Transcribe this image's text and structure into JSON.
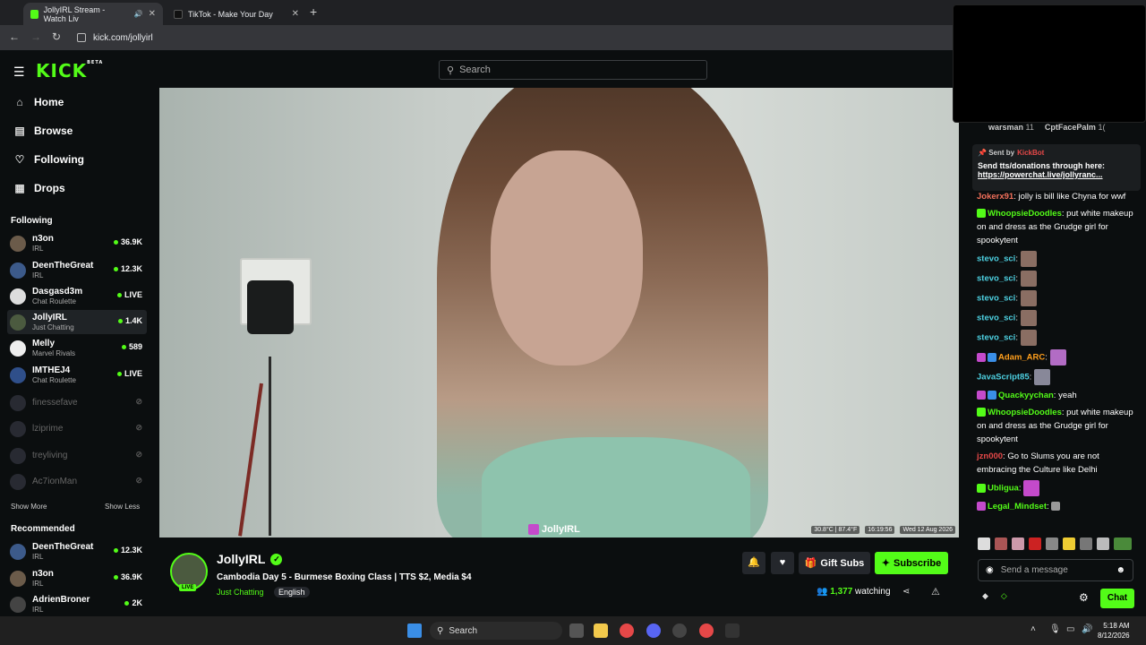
{
  "browser": {
    "tabs": [
      {
        "label": "JollyIRL Stream - Watch Liv",
        "active": true
      },
      {
        "label": "TikTok - Make Your Day",
        "active": false
      }
    ],
    "url": "kick.com/jollyirl"
  },
  "header": {
    "logo": "KICK",
    "logo_badge": "BETA",
    "search_placeholder": "Search"
  },
  "sidebar": {
    "nav": [
      {
        "label": "Home",
        "icon": "home-icon"
      },
      {
        "label": "Browse",
        "icon": "browse-icon"
      },
      {
        "label": "Following",
        "icon": "heart-icon"
      },
      {
        "label": "Drops",
        "icon": "drops-icon"
      }
    ],
    "following_title": "Following",
    "following": [
      {
        "name": "n3on",
        "category": "IRL",
        "viewers": "36.9K"
      },
      {
        "name": "DeenTheGreat",
        "category": "IRL",
        "viewers": "12.3K"
      },
      {
        "name": "Dasgasd3m",
        "category": "Chat Roulette",
        "viewers": "LIVE"
      },
      {
        "name": "JollyIRL",
        "category": "Just Chatting",
        "viewers": "1.4K"
      },
      {
        "name": "Melly",
        "category": "Marvel Rivals",
        "viewers": "589"
      },
      {
        "name": "IMTHEJ4",
        "category": "Chat Roulette",
        "viewers": "LIVE"
      }
    ],
    "offline": [
      "finessefave",
      "lziprime",
      "treyliving",
      "Ac7ionMan"
    ],
    "show_more": "Show More",
    "show_less": "Show Less",
    "recommended_title": "Recommended",
    "recommended": [
      {
        "name": "DeenTheGreat",
        "category": "IRL",
        "viewers": "12.3K"
      },
      {
        "name": "n3on",
        "category": "IRL",
        "viewers": "36.9K"
      },
      {
        "name": "AdrienBroner",
        "category": "IRL",
        "viewers": "2K"
      }
    ]
  },
  "video": {
    "stats": [
      "30.8°C | 87.4°F",
      "16:19:56",
      "Wed 12 Aug 2026"
    ],
    "watermark": "JollyIRL"
  },
  "stream": {
    "streamer": "JollyIRL",
    "live_label": "LIVE",
    "title": "Cambodia Day 5 - Burmese Boxing Class | TTS $2, Media $4",
    "category": "Just Chatting",
    "tag": "English",
    "gift_label": "Gift Subs",
    "subscribe_label": "Subscribe",
    "viewers": "1,377",
    "watching_label": "watching"
  },
  "chat": {
    "gifters": [
      {
        "name": "warsman",
        "count": "11"
      },
      {
        "name": "CptFacePalm",
        "count": "1("
      }
    ],
    "pinned": {
      "sent_by_label": "Sent by",
      "sender": "KickBot",
      "message": "Send tts/donations through here:",
      "link": "https://powerchat.live/jollyranc..."
    },
    "messages": [
      {
        "user": "Jokerx91",
        "color": "#f2705b",
        "text": "jolly is bill like Chyna for wwf"
      },
      {
        "user": "WhoopsieDoodles",
        "color": "#53fc18",
        "text": "put white makeup on and dress as the Grudge girl for spookytent"
      },
      {
        "user": "stevo_sci",
        "color": "#4dd0e1",
        "text": ""
      },
      {
        "user": "stevo_sci",
        "color": "#4dd0e1",
        "text": ""
      },
      {
        "user": "stevo_sci",
        "color": "#4dd0e1",
        "text": ""
      },
      {
        "user": "stevo_sci",
        "color": "#4dd0e1",
        "text": ""
      },
      {
        "user": "stevo_sci",
        "color": "#4dd0e1",
        "text": ""
      },
      {
        "user": "Adam_ARC",
        "color": "#ff9f1c",
        "text": ""
      },
      {
        "user": "JavaScript85",
        "color": "#4dd0e1",
        "text": ""
      },
      {
        "user": "Quackyychan",
        "color": "#53fc18",
        "text": "yeah"
      },
      {
        "user": "WhoopsieDoodles",
        "color": "#53fc18",
        "text": "put white makeup on and dress as the Grudge girl for spookytent"
      },
      {
        "user": "jzn000",
        "color": "#e54848",
        "text": "Go to Slums you are not embracing the Culture like Delhi"
      },
      {
        "user": "Ubligua",
        "color": "#53fc18",
        "text": ""
      },
      {
        "user": "Legal_Mindset",
        "color": "#53fc18",
        "text": ""
      }
    ],
    "input_placeholder": "Send a message",
    "chat_button": "Chat"
  },
  "taskbar": {
    "search": "Search",
    "time": "5:18 AM",
    "date": "8/12/2026"
  },
  "colors": {
    "brand": "#53fc18",
    "bg": "#0b0e0f"
  }
}
